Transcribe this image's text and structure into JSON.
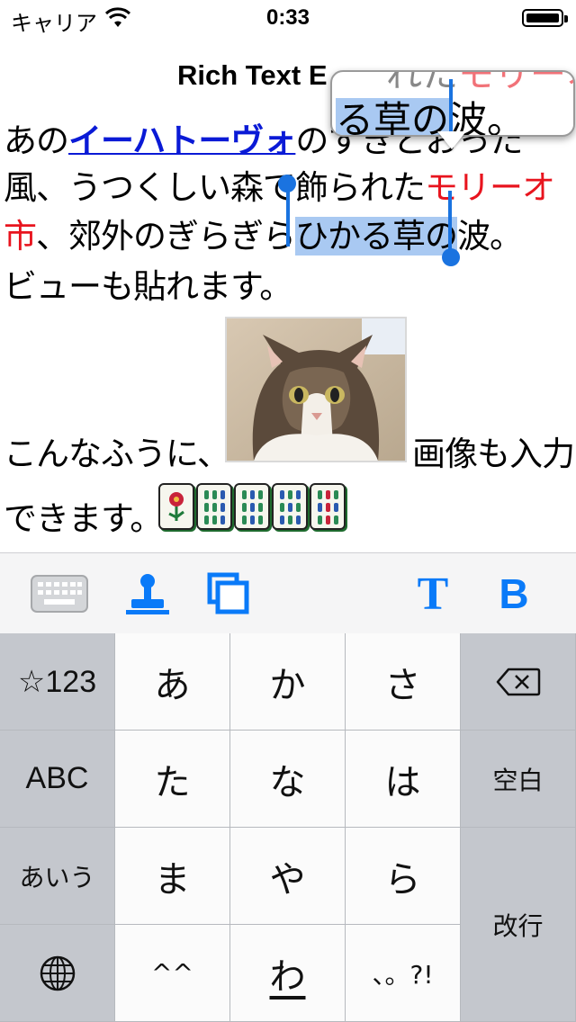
{
  "status_bar": {
    "carrier": "キャリア",
    "time": "0:33"
  },
  "nav": {
    "title": "Rich Text E"
  },
  "editor": {
    "line1_prefix": "あの",
    "line1_link": "イーハトーヴォ",
    "line1_suffix": "のすきとおった",
    "line2_prefix": "風、うつくしい森で飾られた",
    "line2_red": "モリーオ",
    "line3_red": "市",
    "line3_mid": "、郊外のぎらぎら",
    "line3_selected": "ひかる草の",
    "line3_suffix": "波。",
    "line4": "ビューも貼れます。",
    "line5_prefix": "こんなふうに、",
    "line5_suffix": "画像も入力",
    "line6": "できます。"
  },
  "magnifier": {
    "top_text_red": "モリーオ",
    "top_text_plain": "れた",
    "selected": "る草の",
    "rest": "波。"
  },
  "toolbar": {
    "text_style_label": "T",
    "bold_label": "B",
    "icons": [
      "keyboard-icon",
      "stamp-icon",
      "copy-icon"
    ]
  },
  "keyboard": {
    "rows": [
      [
        "☆123",
        "あ",
        "か",
        "さ",
        "⌫"
      ],
      [
        "ABC",
        "た",
        "な",
        "は",
        "空白"
      ],
      [
        "あいう",
        "ま",
        "や",
        "ら",
        "改行"
      ],
      [
        "🌐",
        "^^",
        "わ_",
        "、。?!"
      ]
    ],
    "mode_key": "☆123",
    "abc_key": "ABC",
    "kana_mode_key": "あいう",
    "space_key": "空白",
    "return_key": "改行",
    "key_a": "あ",
    "key_ka": "か",
    "key_sa": "さ",
    "key_ta": "た",
    "key_na": "な",
    "key_ha": "は",
    "key_ma": "ま",
    "key_ya": "や",
    "key_ra": "ら",
    "key_kaomoji": "^^",
    "key_wa": "わ",
    "key_punct": "、。?!"
  }
}
